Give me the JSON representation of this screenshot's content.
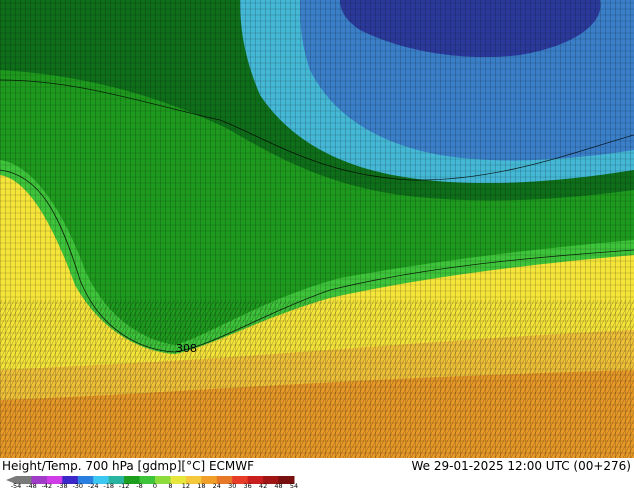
{
  "map": {
    "contour_label": "308",
    "color_zones": {
      "deep": "#2b3a9a",
      "mid_blue": "#3a7fc8",
      "cyan": "#45b8d6",
      "dark_green": "#0f6e1a",
      "green": "#1e9a1e",
      "light_green": "#3ec43a",
      "yellow": "#f5e43a",
      "gold": "#f0c23a",
      "orange": "#e89a28"
    }
  },
  "footer": {
    "title": "Height/Temp. 700 hPa [gdmp][°C] ECMWF",
    "datetime": "We 29-01-2025 12:00 UTC (00+276)"
  },
  "legend": {
    "ticks": [
      "-54",
      "-48",
      "-42",
      "-38",
      "-30",
      "-24",
      "-18",
      "-12",
      "-8",
      "0",
      "8",
      "12",
      "18",
      "24",
      "30",
      "36",
      "42",
      "48",
      "54"
    ],
    "colors": [
      "#7a7a7a",
      "#a03cc8",
      "#d03ce8",
      "#3c28c8",
      "#2a7ee0",
      "#3cc8f0",
      "#28b4a0",
      "#1e9e1e",
      "#3ec43a",
      "#8cdc3c",
      "#e6e63c",
      "#f5c83c",
      "#f0a028",
      "#e67828",
      "#e63c28",
      "#c81e1e",
      "#a01414",
      "#781010"
    ]
  }
}
